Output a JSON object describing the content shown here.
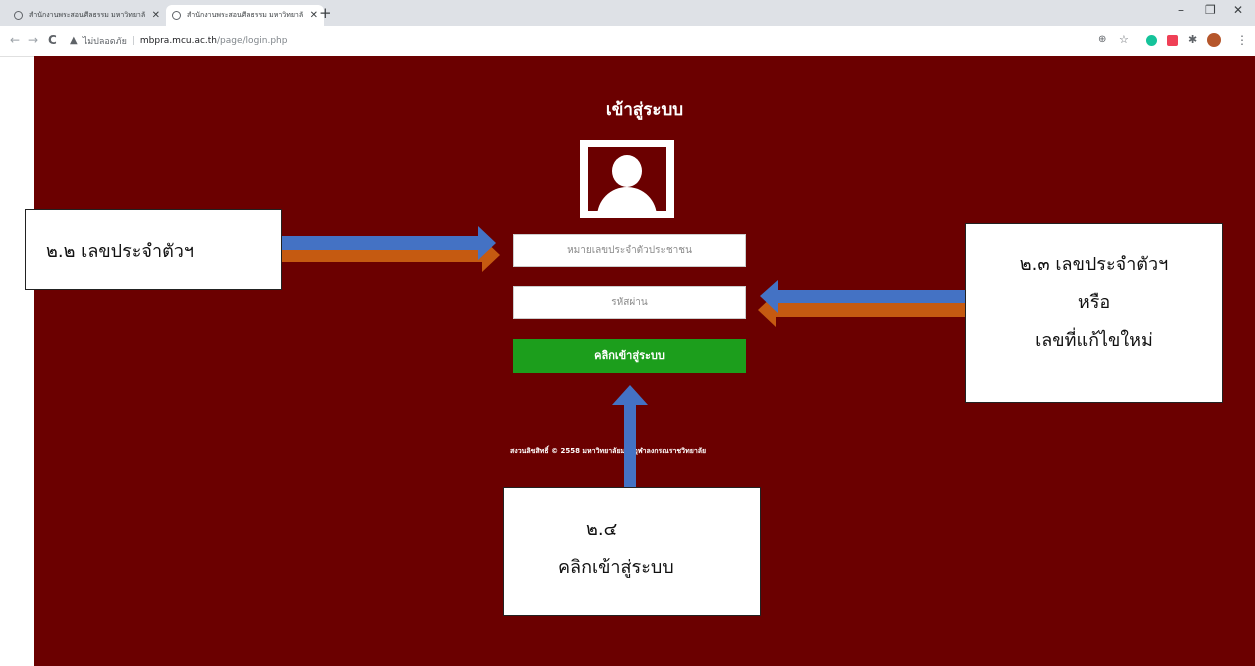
{
  "browser": {
    "tabs": [
      {
        "title": "สำนักงานพระสอนศีลธรรม มหาวิทยาลั",
        "active": false
      },
      {
        "title": "สำนักงานพระสอนศีลธรรม มหาวิทยาลั",
        "active": true
      }
    ],
    "new_tab": "+",
    "window": {
      "minimize": "–",
      "restore": "❐",
      "close": "✕"
    },
    "nav": {
      "back": "←",
      "forward": "→",
      "reload": "C"
    },
    "security_label": "ไม่ปลอดภัย",
    "url_host": "mbpra.mcu.ac.th",
    "url_path": "/page/login.php",
    "toolbar_icons": [
      "zoom-icon",
      "star-icon",
      "grammarly-icon",
      "pocket-icon",
      "extensions-icon",
      "profile-icon",
      "menu-icon"
    ]
  },
  "login": {
    "title": "เข้าสู่ระบบ",
    "id_placeholder": "หมายเลขประจำตัวประชาชน",
    "password_placeholder": "รหัสผ่าน",
    "submit_label": "คลิกเข้าสู่ระบบ",
    "copyright": "สงวนลิขสิทธิ์ © 2558 มหาวิทยาลัยมหาจุฬาลงกรณราชวิทยาลัย"
  },
  "annotations": {
    "left": "๒.๒ เลขประจำตัวฯ",
    "right": [
      "๒.๓ เลขประจำตัวฯ",
      "หรือ",
      "เลขที่แก้ไขใหม่"
    ],
    "bottom": [
      "๒.๔",
      "คลิกเข้าสู่ระบบ"
    ]
  },
  "colors": {
    "page_background": "#6b0000",
    "login_button": "#1c9e1c",
    "arrow_fill": "#4472c4",
    "arrow_shadow": "#c55a11"
  }
}
